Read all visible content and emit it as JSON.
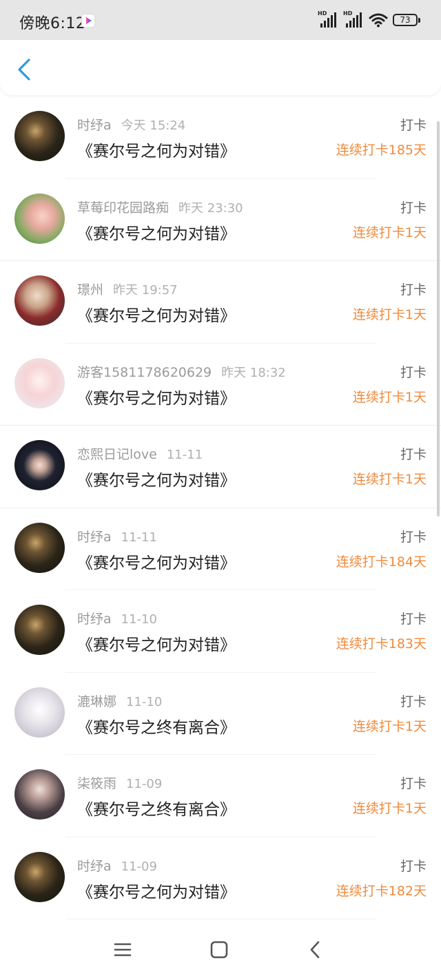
{
  "status_bar": {
    "time": "傍晚6:12",
    "battery": "73"
  },
  "colors": {
    "accent": "#f08a3b",
    "back_arrow": "#2c9be0"
  },
  "items": [
    {
      "name": "时纾a",
      "time": "今天 15:24",
      "title": "《赛尔号之何为对错》",
      "type": "打卡",
      "streak": "连续打卡185天",
      "avatar": "dark-figure"
    },
    {
      "name": "草莓印花园路痴",
      "time": "昨天 23:30",
      "title": "《赛尔号之何为对错》",
      "type": "打卡",
      "streak": "连续打卡1天",
      "avatar": "girl-pink"
    },
    {
      "name": "璟州",
      "time": "昨天 19:57",
      "title": "《赛尔号之何为对错》",
      "type": "打卡",
      "streak": "连续打卡1天",
      "avatar": "anime-red"
    },
    {
      "name": "游客1581178620629",
      "time": "昨天 18:32",
      "title": "《赛尔号之何为对错》",
      "type": "打卡",
      "streak": "连续打卡1天",
      "avatar": "anime-light"
    },
    {
      "name": "恋熙日记love",
      "time": "11-11",
      "title": "《赛尔号之何为对错》",
      "type": "打卡",
      "streak": "连续打卡1天",
      "avatar": "anime-dark"
    },
    {
      "name": "时纾a",
      "time": "11-11",
      "title": "《赛尔号之何为对错》",
      "type": "打卡",
      "streak": "连续打卡184天",
      "avatar": "dark-figure"
    },
    {
      "name": "时纾a",
      "time": "11-10",
      "title": "《赛尔号之何为对错》",
      "type": "打卡",
      "streak": "连续打卡183天",
      "avatar": "dark-figure"
    },
    {
      "name": "漉琳娜",
      "time": "11-10",
      "title": "《赛尔号之终有离合》",
      "type": "打卡",
      "streak": "连续打卡1天",
      "avatar": "anime-white"
    },
    {
      "name": "柒筱雨",
      "time": "11-09",
      "title": "《赛尔号之终有离合》",
      "type": "打卡",
      "streak": "连续打卡1天",
      "avatar": "anime-gray"
    },
    {
      "name": "时纾a",
      "time": "11-09",
      "title": "《赛尔号之何为对错》",
      "type": "打卡",
      "streak": "连续打卡182天",
      "avatar": "dark-figure"
    }
  ]
}
